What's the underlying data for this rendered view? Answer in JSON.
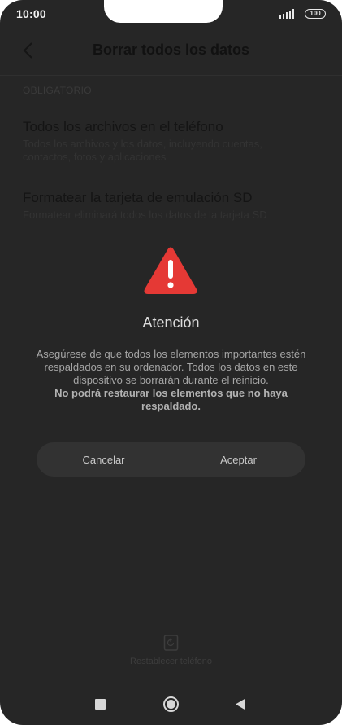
{
  "status_bar": {
    "time": "10:00",
    "battery": "100",
    "icons": [
      "signal-icon",
      "battery-icon"
    ]
  },
  "header": {
    "title": "Borrar todos los datos",
    "back_icon": "chevron-left-icon"
  },
  "section": {
    "label": "OBLIGATORIO"
  },
  "options": [
    {
      "title": "Todos los archivos en el teléfono",
      "description": "Todos los archivos y los datos, incluyendo cuentas, contactos, fotos y aplicaciones"
    },
    {
      "title": "Formatear la tarjeta de emulación SD",
      "description": "Formatear eliminará todos los datos de la tarjeta SD"
    }
  ],
  "dialog": {
    "icon": "warning-icon",
    "title": "Atención",
    "message": "Asegúrese de que todos los elementos importantes estén respaldados en su ordenador. Todos los datos en este dispositivo se borrarán durante el reinicio.",
    "message_bold": "No podrá restaurar los elementos que no haya respaldado.",
    "cancel_label": "Cancelar",
    "accept_label": "Aceptar",
    "accent_color": "#e53935"
  },
  "bottom": {
    "reset_icon": "reset-phone-icon",
    "reset_label": "Restablecer teléfono"
  },
  "nav_bar": {
    "icons": [
      "recents-icon",
      "home-icon",
      "back-icon"
    ]
  }
}
